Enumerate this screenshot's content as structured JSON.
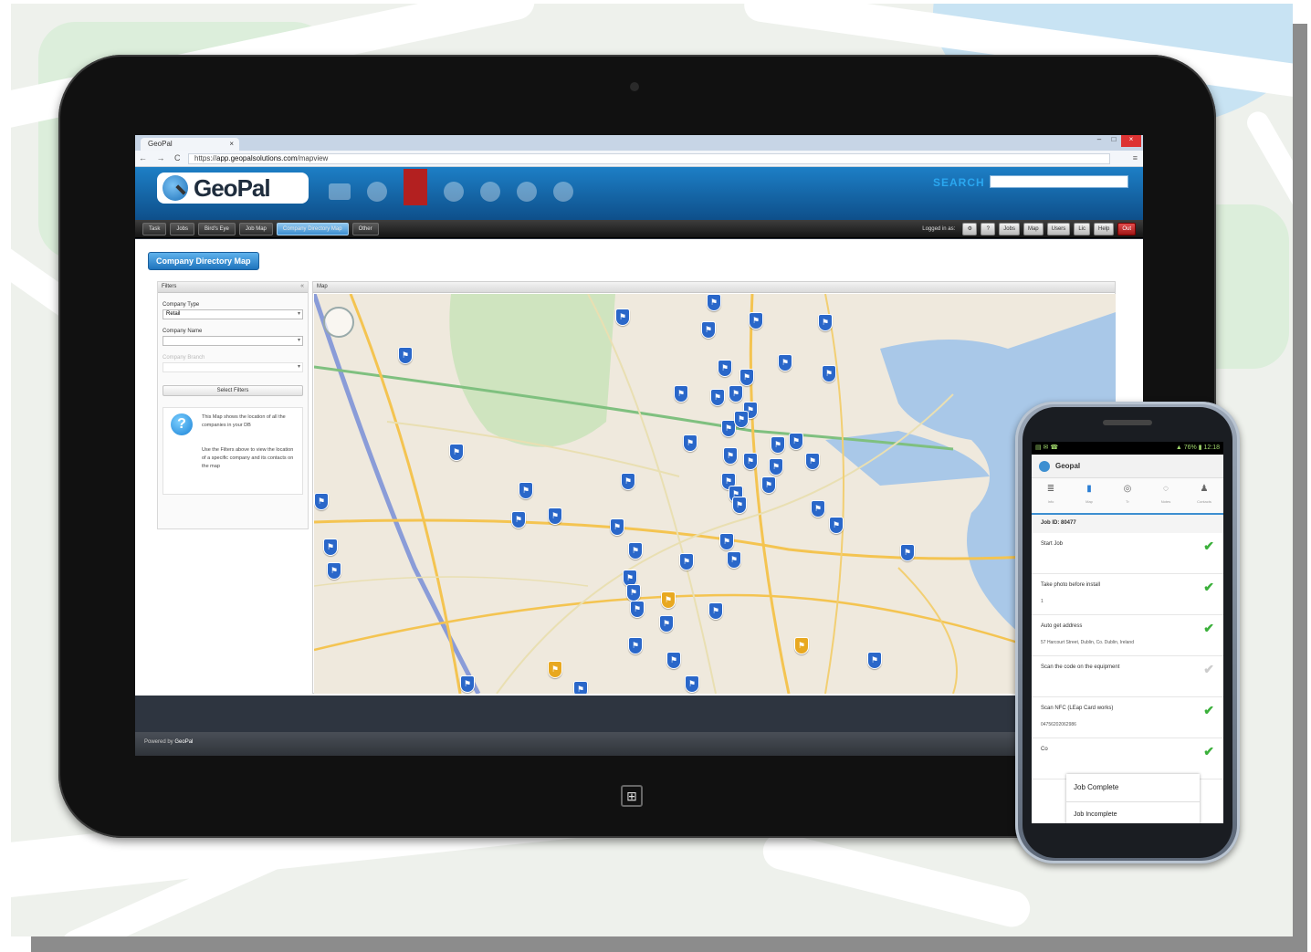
{
  "browser": {
    "tab_title": "GeoPal",
    "tab_close": "×",
    "window_buttons": [
      "–",
      "□",
      "×"
    ],
    "nav_glyphs": "← → C",
    "url_scheme": "https://",
    "url_host": "app.geopalsolutions.com",
    "url_path": "/mapview",
    "menu_glyph": "≡"
  },
  "app": {
    "logo_text": "GeoPal",
    "search_label": "SEARCH",
    "nav_tabs": [
      "Task",
      "Jobs",
      "Bird's Eye",
      "Job Map",
      "Company Directory Map",
      "Other"
    ],
    "active_nav_index": 4,
    "nav_right_label": "Logged in as: ",
    "nav_right_buttons": [
      "⚙",
      "?",
      "Jobs",
      "Map",
      "Users",
      "Lic",
      "Help",
      "Out"
    ],
    "page_title": "Company Directory Map",
    "filter": {
      "header": "Filters",
      "company_type_label": "Company Type",
      "company_type_value": "Retail",
      "company_name_label": "Company Name",
      "company_name_value": "",
      "third_label": "Company Branch",
      "button_label": "Select Filters",
      "info_text_1": "This Map shows the location of all the companies in your DB",
      "info_text_2": "Use the Filters above to view the location of a specific company and its contacts on the map"
    },
    "map_header": "Map",
    "footer_text": "Powered by",
    "footer_brand": "GeoPal"
  },
  "phone": {
    "status_left": "▤ ✉ ☎",
    "status_right": "▲ 76% ▮ 12:18",
    "app_title": "Geopal",
    "tabs": [
      {
        "icon": "≣",
        "label": "Info"
      },
      {
        "icon": "▮",
        "label": "Map"
      },
      {
        "icon": "◎",
        "label": "Tr"
      },
      {
        "icon": "◌",
        "label": "Notes"
      },
      {
        "icon": "♟",
        "label": "Contacts"
      }
    ],
    "job_id": "Job ID: 80477",
    "steps": [
      {
        "label": "Start Job",
        "sub": "",
        "done": true
      },
      {
        "label": "Take photo before install",
        "sub": "1",
        "done": true
      },
      {
        "label": "Auto get address",
        "sub": "57 Harcourt Street, Dublin, Co. Dublin, Ireland",
        "done": true
      },
      {
        "label": "Scan the code on the equipment",
        "sub": "",
        "done": false
      },
      {
        "label": "Scan NFC (LEap Card works)",
        "sub": "04756202062986",
        "done": true
      },
      {
        "label": "Co",
        "sub": "",
        "done": true
      }
    ],
    "dropdown": [
      "Job Complete",
      "Job Incomplete"
    ]
  }
}
